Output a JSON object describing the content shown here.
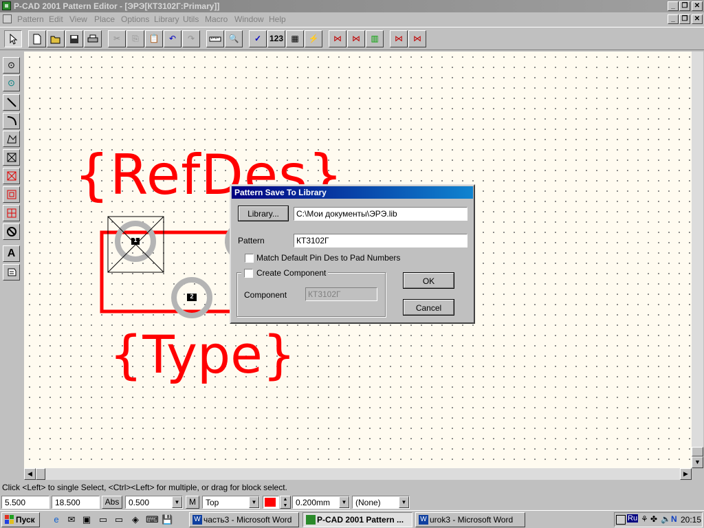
{
  "window": {
    "title": "P-CAD 2001 Pattern Editor - [ЭРЭ[КТ3102Г:Primary]]",
    "buttons": [
      "_",
      "❐",
      "✕"
    ]
  },
  "menu": [
    "Pattern",
    "Edit",
    "View",
    "Place",
    "Options",
    "Library",
    "Utils",
    "Macro",
    "Window",
    "Help"
  ],
  "toolbar": {
    "text_123": "123"
  },
  "palette_text_tool": "A",
  "canvas": {
    "refdes": "{RefDes}",
    "type": "{Type}",
    "pad1": "1",
    "pad2": "2"
  },
  "dialog": {
    "title": "Pattern Save To Library",
    "library_button": "Library...",
    "library_path": "C:\\Мои документы\\ЭРЭ.lib",
    "pattern_label": "Pattern",
    "pattern_value": "КТ3102Г",
    "match_label": "Match Default Pin Des to Pad Numbers",
    "create_label": "Create Component",
    "component_label": "Component",
    "component_value": "КТ3102Г",
    "ok": "OK",
    "cancel": "Cancel"
  },
  "status": {
    "hint": "Click <Left> to single Select, <Ctrl><Left> for multiple, or drag for block select.",
    "x": "5.500",
    "y": "18.500",
    "abs": "Abs",
    "grid": "0.500",
    "m": "M",
    "layer": "Top",
    "color": "#ff0000",
    "width": "0.200mm",
    "none": "(None)"
  },
  "taskbar": {
    "start": "Пуск",
    "tasks": [
      {
        "label": "часть3 - Microsoft Word",
        "active": false
      },
      {
        "label": "P-CAD 2001 Pattern ...",
        "active": true
      },
      {
        "label": "urok3 - Microsoft Word",
        "active": false
      }
    ],
    "lang": "Ru",
    "time": "20:15"
  },
  "colors": {
    "outline": "#ff0000",
    "pad": "#b4b4b4",
    "dialog_title": "#000080"
  }
}
